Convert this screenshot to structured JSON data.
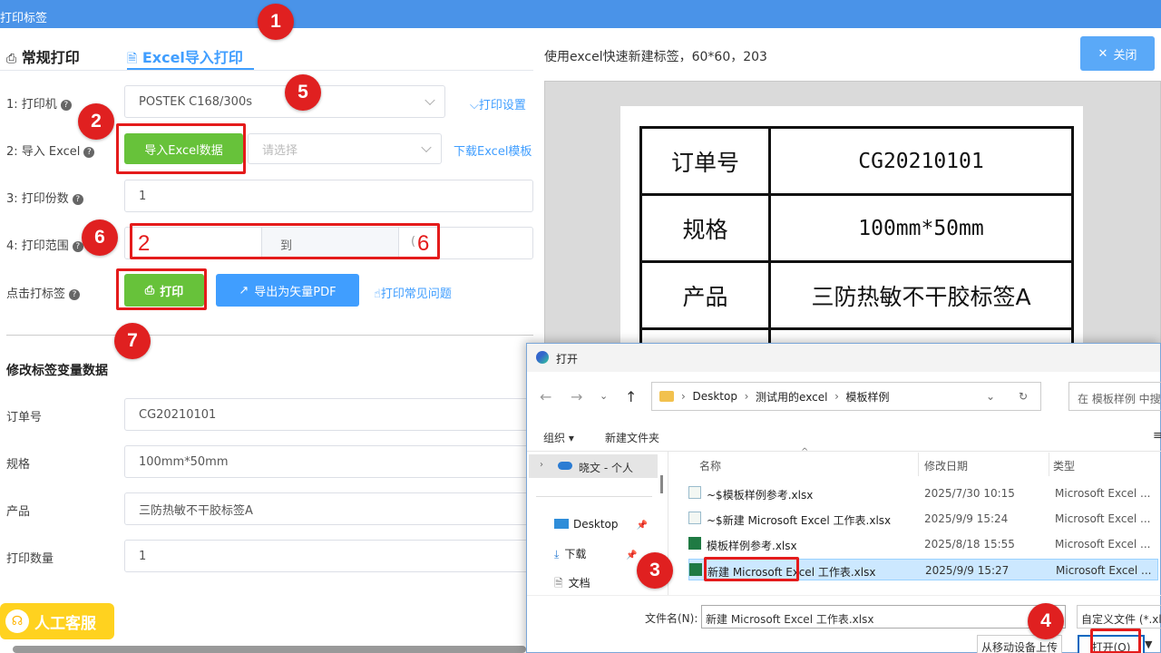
{
  "window": {
    "title": "打印标签"
  },
  "tabs": {
    "normal": "常规打印",
    "excel": "Excel导入打印"
  },
  "preview_title": "使用excel快速新建标签，60*60，203",
  "close_button": "关闭",
  "form": {
    "printer_label": "1: 打印机",
    "printer_value": "POSTEK C168/300s",
    "print_settings": "打印设置",
    "import_label": "2: 导入 Excel",
    "import_button": "导入Excel数据",
    "import_placeholder": "请选择",
    "download_template": "下载Excel模板",
    "copies_label": "3: 打印份数",
    "copies_value": "1",
    "range_label": "4: 打印范围",
    "range_from": "2",
    "range_to_label": "到",
    "range_to_partial": "(",
    "range_to": "6",
    "click_label": "点击打标签",
    "print_button": "打印",
    "export_button": "导出为矢量PDF",
    "faq": "打印常见问题"
  },
  "variables": {
    "title": "修改标签变量数据",
    "items": [
      {
        "label": "订单号",
        "value": "CG20210101"
      },
      {
        "label": "规格",
        "value": "100mm*50mm"
      },
      {
        "label": "产品",
        "value": "三防热敏不干胶标签A"
      },
      {
        "label": "打印数量",
        "value": "1"
      }
    ]
  },
  "label_table": [
    {
      "key": "订单号",
      "value": "CG20210101"
    },
    {
      "key": "规格",
      "value": "100mm*50mm"
    },
    {
      "key": "产品",
      "value": "三防热敏不干胶标签A"
    }
  ],
  "customer_service": "人工客服",
  "badges": [
    "1",
    "2",
    "3",
    "4",
    "5",
    "6",
    "7"
  ],
  "dialog": {
    "title": "打开",
    "path": [
      "Desktop",
      "测试用的excel",
      "模板样例"
    ],
    "search_placeholder": "在 模板样例 中搜",
    "organize": "组织",
    "new_folder": "新建文件夹",
    "nav": [
      {
        "label": "晓文 - 个人",
        "icon": "cloud-icon"
      },
      {
        "label": "Desktop",
        "icon": "desktop-icon"
      },
      {
        "label": "下载",
        "icon": "download-icon"
      },
      {
        "label": "文档",
        "icon": "document-icon"
      }
    ],
    "columns": {
      "name": "名称",
      "date": "修改日期",
      "type": "类型"
    },
    "files": [
      {
        "name": "~$模板样例参考.xlsx",
        "date": "2025/7/30 10:15",
        "type": "Microsoft Excel ..."
      },
      {
        "name": "~$新建 Microsoft Excel 工作表.xlsx",
        "date": "2025/9/9 15:24",
        "type": "Microsoft Excel ..."
      },
      {
        "name": "模板样例参考.xlsx",
        "date": "2025/8/18 15:55",
        "type": "Microsoft Excel ..."
      },
      {
        "name": "新建 Microsoft Excel 工作表.xlsx",
        "date": "2025/9/9 15:27",
        "type": "Microsoft Excel ..."
      }
    ],
    "filename_label": "文件名(N):",
    "filename_value": "新建 Microsoft Excel 工作表.xlsx",
    "filter": "自定义文件 (*.xls",
    "from_mobile": "从移动设备上传",
    "open": "打开(O)"
  },
  "colors": {
    "accent": "#409eff",
    "green": "#67c23a",
    "red": "#e41b1b",
    "titlebar": "#4a93e8"
  }
}
